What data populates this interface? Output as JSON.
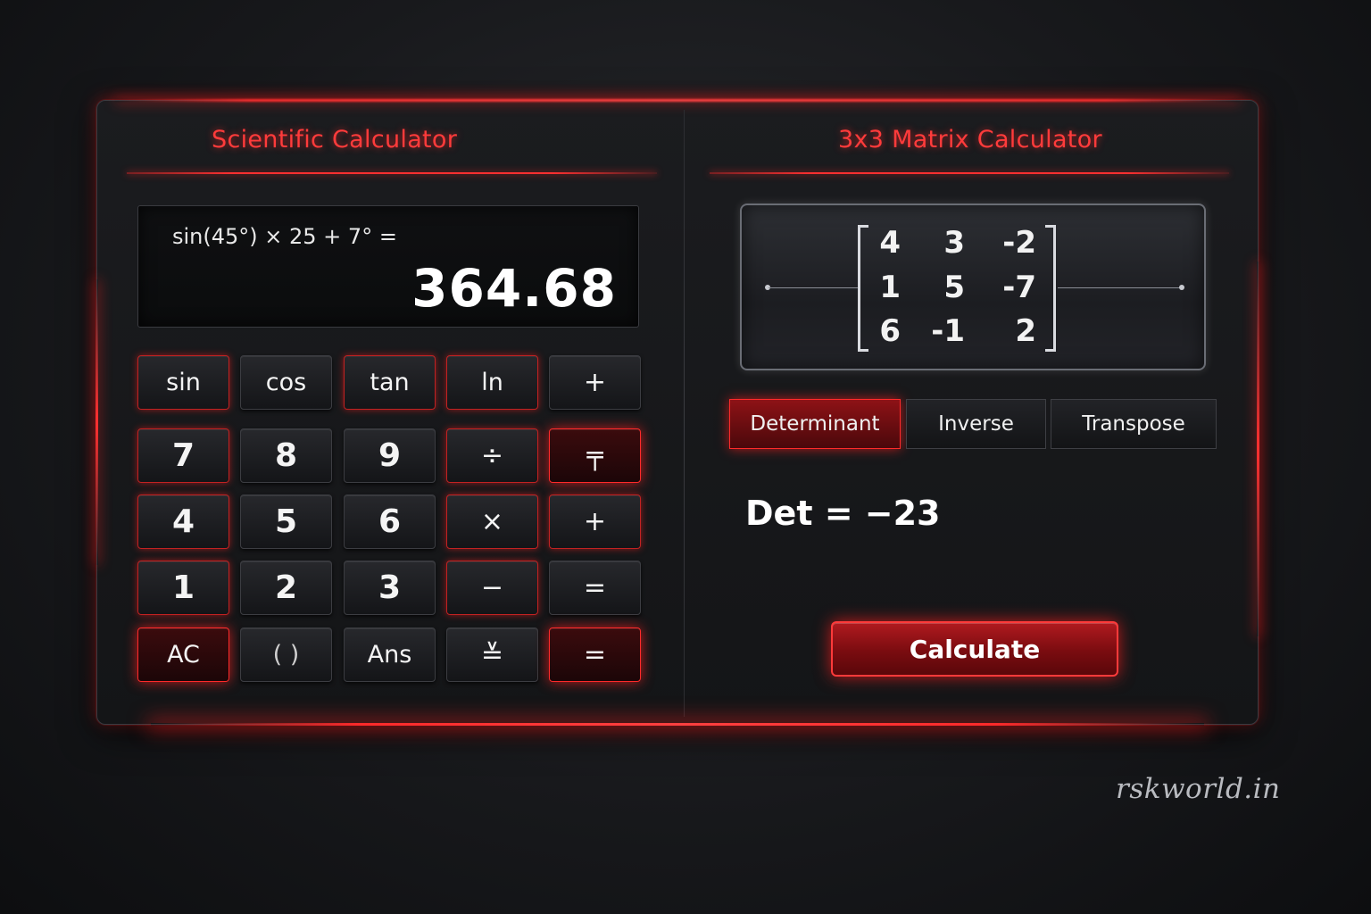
{
  "scientific": {
    "title": "Scientific Calculator",
    "expression": "sin(45°) × 25 + 7° =",
    "result": "364.68",
    "keys": [
      [
        "sin",
        "cos",
        "tan",
        "ln",
        "+"
      ],
      [
        "7",
        "8",
        "9",
        "÷",
        "╤"
      ],
      [
        "4",
        "5",
        "6",
        "×",
        "+"
      ],
      [
        "1",
        "2",
        "3",
        "−",
        "="
      ],
      [
        "AC",
        "( )",
        "Ans",
        "≚",
        "="
      ]
    ]
  },
  "matrix": {
    "title": "3x3 Matrix Calculator",
    "values": [
      [
        "4",
        "3",
        "-2"
      ],
      [
        "1",
        "5",
        "-7"
      ],
      [
        "6",
        "-1",
        "2"
      ]
    ],
    "operations": [
      "Determinant",
      "Inverse",
      "Transpose"
    ],
    "active_operation": "Determinant",
    "result": "Det = −23",
    "calculate_label": "Calculate"
  },
  "watermark": "rskworld.in",
  "colors": {
    "accent": "#ff2a2a",
    "background": "#18191c"
  }
}
